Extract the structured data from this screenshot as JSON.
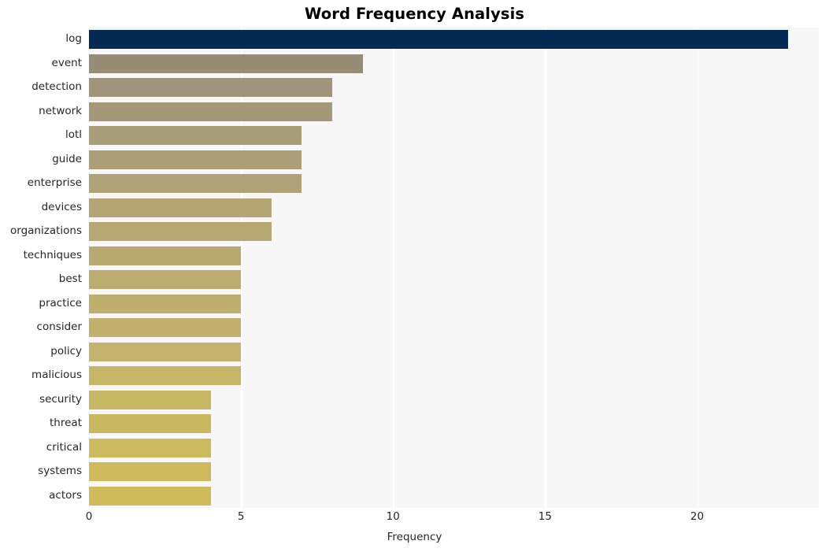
{
  "chart_data": {
    "type": "bar",
    "orientation": "horizontal",
    "title": "Word Frequency Analysis",
    "xlabel": "Frequency",
    "ylabel": "",
    "categories": [
      "log",
      "event",
      "detection",
      "network",
      "lotl",
      "guide",
      "enterprise",
      "devices",
      "organizations",
      "techniques",
      "best",
      "practice",
      "consider",
      "policy",
      "malicious",
      "security",
      "threat",
      "critical",
      "systems",
      "actors"
    ],
    "values": [
      23,
      9,
      8,
      8,
      7,
      7,
      7,
      6,
      6,
      5,
      5,
      5,
      5,
      5,
      5,
      4,
      4,
      4,
      4,
      4
    ],
    "xlim": [
      0,
      24
    ],
    "xticks": [
      0,
      5,
      10,
      15,
      20
    ],
    "xticklabels": [
      "0",
      "5",
      "10",
      "15",
      "20"
    ],
    "grid": true,
    "grid_axis": "x",
    "legend": "none",
    "bar_colors": [
      "#042a54",
      "#968d74",
      "#a0957a",
      "#a49879",
      "#aa9e78",
      "#ac9f77",
      "#afa276",
      "#b3a574",
      "#b6a773",
      "#b9aa71",
      "#bcac70",
      "#bfaf6e",
      "#c2b16c",
      "#c4b36a",
      "#c6b567",
      "#c8b764",
      "#cab861",
      "#ccba5f",
      "#ceba5c",
      "#cfbb5a"
    ],
    "plot_background": "#f7f7f7",
    "gridline_color": "#ffffff",
    "figure_background": "#ffffff",
    "text_color": "#262626",
    "title_color": "#000000"
  }
}
